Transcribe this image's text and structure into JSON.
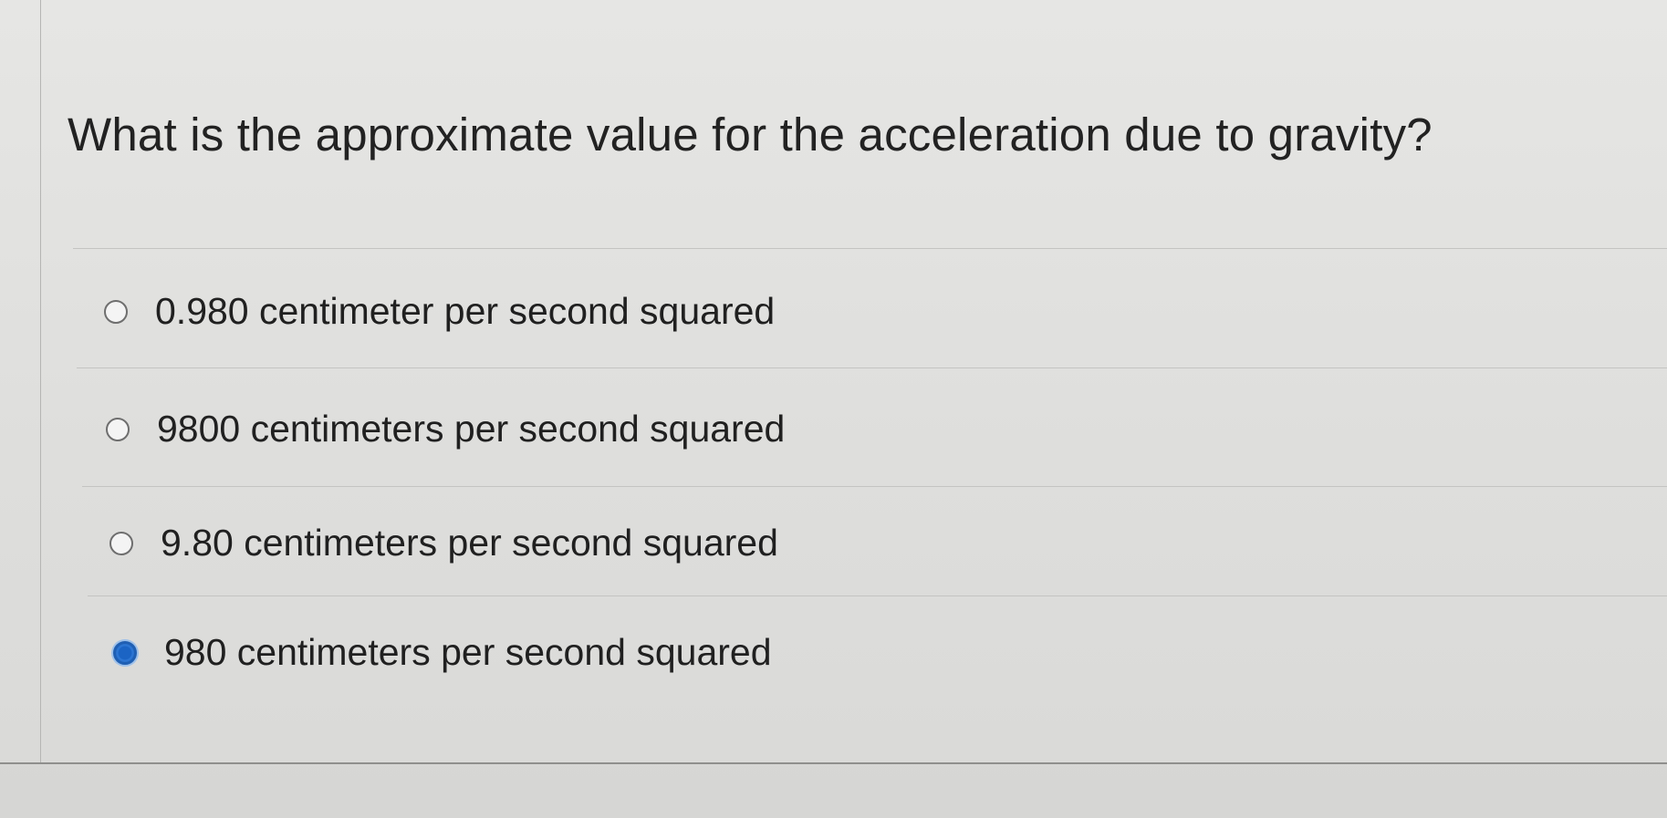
{
  "question": {
    "text": "What is the approximate value for the acceleration due to gravity?"
  },
  "options": [
    {
      "label": "0.980 centimeter per second squared",
      "selected": false
    },
    {
      "label": "9800 centimeters per second squared",
      "selected": false
    },
    {
      "label": "9.80 centimeters per second squared",
      "selected": false
    },
    {
      "label": "980 centimeters per second squared",
      "selected": true
    }
  ],
  "colors": {
    "selected_radio": "#1f5fb3",
    "text": "#202020"
  }
}
